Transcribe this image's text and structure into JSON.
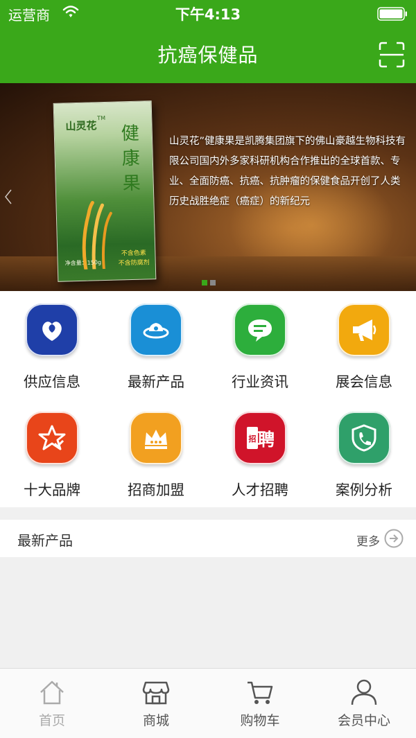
{
  "status": {
    "carrier": "运营商",
    "time": "下午4:13"
  },
  "header": {
    "title": "抗癌保健品"
  },
  "banner": {
    "text": "山灵花”健康果是凯腾集团旗下的佛山豪越生物科技有限公司国内外多家科研机构合作推出的全球首款、专业、全面防癌、抗癌、抗肿瘤的保健食品开创了人类历史战胜绝症（癌症）的新纪元",
    "product": {
      "brand": "山灵花",
      "tm": "TM",
      "name": "健康果",
      "weight": "净含量：150g",
      "slogan_1": "不含色素",
      "slogan_2": "不含防腐剂"
    },
    "slide_count": 2,
    "active_slide": 1,
    "colors": {
      "dot_active": "#3aa81a",
      "dot_inactive": "#888888"
    }
  },
  "grid": [
    {
      "label": "供应信息",
      "icon": "heart-flower-icon",
      "color": "#1f3fa8"
    },
    {
      "label": "最新产品",
      "icon": "cloud-ring-icon",
      "color": "#1a8fd6"
    },
    {
      "label": "行业资讯",
      "icon": "chat-bubble-icon",
      "color": "#2dae3c"
    },
    {
      "label": "展会信息",
      "icon": "megaphone-icon",
      "color": "#f2a90e"
    },
    {
      "label": "十大品牌",
      "icon": "star-check-icon",
      "color": "#e8451a"
    },
    {
      "label": "招商加盟",
      "icon": "crown-icon",
      "color": "#f2a020"
    },
    {
      "label": "人才招聘",
      "icon": "recruit-icon",
      "color": "#d0142a"
    },
    {
      "label": "案例分析",
      "icon": "phone-shield-icon",
      "color": "#2fa06a"
    }
  ],
  "section": {
    "title": "最新产品",
    "more": "更多"
  },
  "nav": [
    {
      "label": "首页",
      "icon": "home-icon",
      "active": true
    },
    {
      "label": "商城",
      "icon": "shop-icon",
      "active": false
    },
    {
      "label": "购物车",
      "icon": "cart-icon",
      "active": false
    },
    {
      "label": "会员中心",
      "icon": "user-icon",
      "active": false
    }
  ],
  "colors": {
    "brand_green": "#3aa81a",
    "nav_active": "#aaaaaa",
    "nav_inactive": "#555555"
  }
}
